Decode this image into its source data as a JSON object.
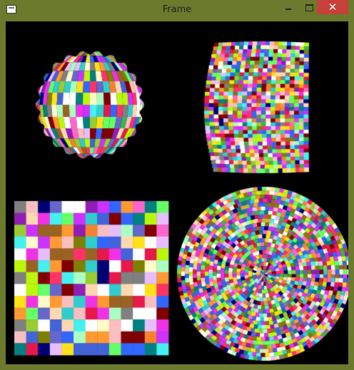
{
  "window": {
    "title": "Frame",
    "close_glyph": "✕",
    "frame_color": "#6b7a2c",
    "close_color": "#c7403b",
    "client_background": "#000000"
  },
  "canvas": {
    "shapes": [
      "mosaic-sphere",
      "mosaic-warped-square",
      "mosaic-square",
      "mosaic-disc"
    ],
    "palette": [
      "#e6194b",
      "#3cb44b",
      "#ffe119",
      "#4363d8",
      "#f58231",
      "#911eb4",
      "#46f0f0",
      "#f032e6",
      "#bcf60c",
      "#fabebe",
      "#008080",
      "#e6beff",
      "#9a6324",
      "#fffac8",
      "#800000",
      "#aaffc3",
      "#808000",
      "#ffd8b1",
      "#000075",
      "#808080",
      "#ffffff",
      "#3366ff",
      "#ff66cc",
      "#66ff66",
      "#ff9933",
      "#33cccc",
      "#cc33ff",
      "#99cc33",
      "#ff3366",
      "#6666cc"
    ]
  }
}
